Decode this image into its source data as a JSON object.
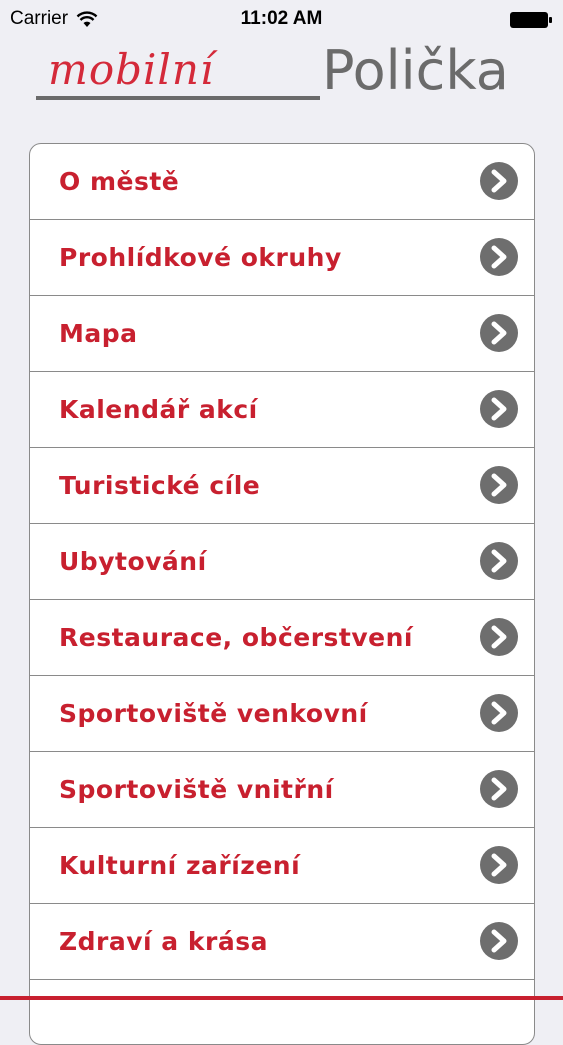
{
  "status_bar": {
    "carrier": "Carrier",
    "time": "11:02 AM"
  },
  "header": {
    "logo_script": "mobilní",
    "logo_town": "Polička"
  },
  "colors": {
    "accent_red": "#c8202f",
    "logo_gray": "#6b6b6b",
    "chevron_gray": "#6e6e6e",
    "background": "#efeff4"
  },
  "menu": {
    "items": [
      {
        "label": "O městě"
      },
      {
        "label": "Prohlídkové okruhy"
      },
      {
        "label": "Mapa"
      },
      {
        "label": "Kalendář akcí"
      },
      {
        "label": "Turistické cíle"
      },
      {
        "label": "Ubytování"
      },
      {
        "label": "Restaurace, občerstvení"
      },
      {
        "label": "Sportoviště venkovní"
      },
      {
        "label": "Sportoviště vnitřní"
      },
      {
        "label": "Kulturní zařízení"
      },
      {
        "label": "Zdraví a krása"
      }
    ],
    "item_icon": "chevron-right-icon"
  }
}
